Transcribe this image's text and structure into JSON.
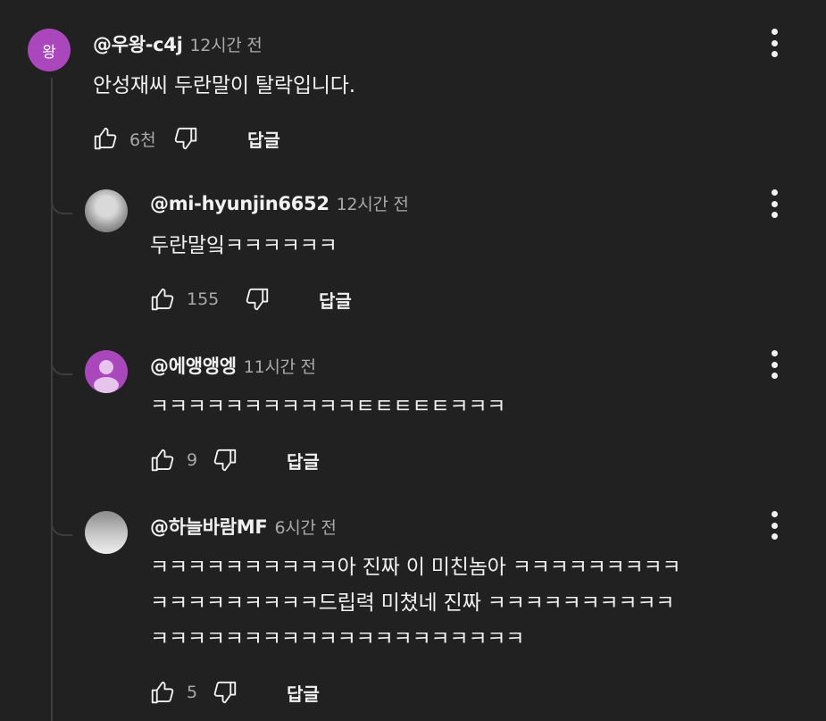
{
  "comments": [
    {
      "author": "@우왕-c4j",
      "avatar_letter": "왕",
      "time": "12시간 전",
      "text": [
        "안성재씨 두란말이 탈락입니다."
      ],
      "likes": "6천",
      "reply_label": "답글"
    },
    {
      "author": "@mi-hyunjin6652",
      "avatar_letter": "",
      "time": "12시간 전",
      "text": [
        "두란말잌ㅋㅋㅋㅋㅋㅋ"
      ],
      "likes": "155",
      "reply_label": "답글"
    },
    {
      "author": "@에앵앵엥",
      "avatar_letter": "",
      "time": "11시간 전",
      "text": [
        "ㅋㅋㅋㅋㅋㅋㅋㅋㅋㅋㅋㅌㅌㅌㅌㅌㅋㅋㅋ"
      ],
      "likes": "9",
      "reply_label": "답글"
    },
    {
      "author": "@하늘바람MF",
      "avatar_letter": "",
      "time": "6시간 전",
      "text": [
        "ㅋㅋㅋㅋㅋㅋㅋㅋㅋㅋ아 진짜 이 미친놈아 ㅋㅋㅋㅋㅋㅋㅋㅋㅋ",
        "ㅋㅋㅋㅋㅋㅋㅋㅋㅋ드립력 미쳤네 진짜 ㅋㅋㅋㅋㅋㅋㅋㅋㅋㅋ",
        "ㅋㅋㅋㅋㅋㅋㅋㅋㅋㅋㅋㅋㅋㅋㅋㅋㅋㅋㅋㅋ"
      ],
      "likes": "5",
      "reply_label": "답글"
    }
  ],
  "icons": {
    "like": "thumbs-up-icon",
    "dislike": "thumbs-down-icon",
    "menu": "more-vertical-icon"
  },
  "colors": {
    "background": "#212121",
    "text_primary": "#f1f1f1",
    "text_secondary": "#aaaaaa",
    "avatar_purple": "#ab47bc"
  }
}
